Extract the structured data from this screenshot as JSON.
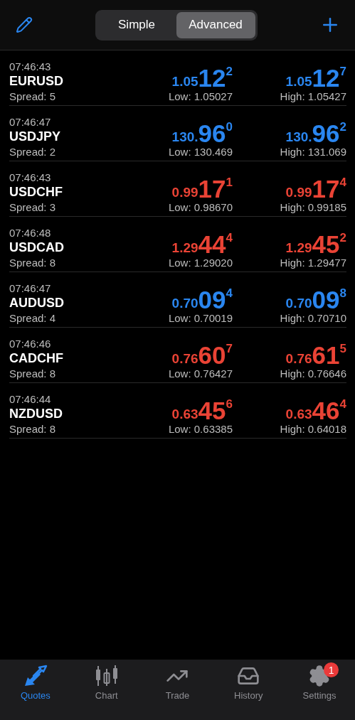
{
  "toolbar": {
    "segments": [
      {
        "label": "Simple",
        "selected": false
      },
      {
        "label": "Advanced",
        "selected": true
      }
    ]
  },
  "quotes": [
    {
      "time": "07:46:43",
      "symbol": "EURUSD",
      "spread": "Spread: 5",
      "color": "#2a86f0",
      "bid": {
        "small": "1.05",
        "big": "12",
        "sup": "2"
      },
      "ask": {
        "small": "1.05",
        "big": "12",
        "sup": "7"
      },
      "low": "Low: 1.05027",
      "high": "High: 1.05427"
    },
    {
      "time": "07:46:47",
      "symbol": "USDJPY",
      "spread": "Spread: 2",
      "color": "#2a86f0",
      "bid": {
        "small": "130.",
        "big": "96",
        "sup": "0"
      },
      "ask": {
        "small": "130.",
        "big": "96",
        "sup": "2"
      },
      "low": "Low: 130.469",
      "high": "High: 131.069"
    },
    {
      "time": "07:46:43",
      "symbol": "USDCHF",
      "spread": "Spread: 3",
      "color": "#ea4335",
      "bid": {
        "small": "0.99",
        "big": "17",
        "sup": "1"
      },
      "ask": {
        "small": "0.99",
        "big": "17",
        "sup": "4"
      },
      "low": "Low: 0.98670",
      "high": "High: 0.99185"
    },
    {
      "time": "07:46:48",
      "symbol": "USDCAD",
      "spread": "Spread: 8",
      "color": "#ea4335",
      "bid": {
        "small": "1.29",
        "big": "44",
        "sup": "4"
      },
      "ask": {
        "small": "1.29",
        "big": "45",
        "sup": "2"
      },
      "low": "Low: 1.29020",
      "high": "High: 1.29477"
    },
    {
      "time": "07:46:47",
      "symbol": "AUDUSD",
      "spread": "Spread: 4",
      "color": "#2a86f0",
      "bid": {
        "small": "0.70",
        "big": "09",
        "sup": "4"
      },
      "ask": {
        "small": "0.70",
        "big": "09",
        "sup": "8"
      },
      "low": "Low: 0.70019",
      "high": "High: 0.70710"
    },
    {
      "time": "07:46:46",
      "symbol": "CADCHF",
      "spread": "Spread: 8",
      "color": "#ea4335",
      "bid": {
        "small": "0.76",
        "big": "60",
        "sup": "7"
      },
      "ask": {
        "small": "0.76",
        "big": "61",
        "sup": "5"
      },
      "low": "Low: 0.76427",
      "high": "High: 0.76646"
    },
    {
      "time": "07:46:44",
      "symbol": "NZDUSD",
      "spread": "Spread: 8",
      "color": "#ea4335",
      "bid": {
        "small": "0.63",
        "big": "45",
        "sup": "6"
      },
      "ask": {
        "small": "0.63",
        "big": "46",
        "sup": "4"
      },
      "low": "Low: 0.63385",
      "high": "High: 0.64018"
    }
  ],
  "tabbar": [
    {
      "label": "Quotes",
      "selected": true
    },
    {
      "label": "Chart",
      "selected": false
    },
    {
      "label": "Trade",
      "selected": false
    },
    {
      "label": "History",
      "selected": false
    },
    {
      "label": "Settings",
      "selected": false,
      "badge": "1"
    }
  ]
}
